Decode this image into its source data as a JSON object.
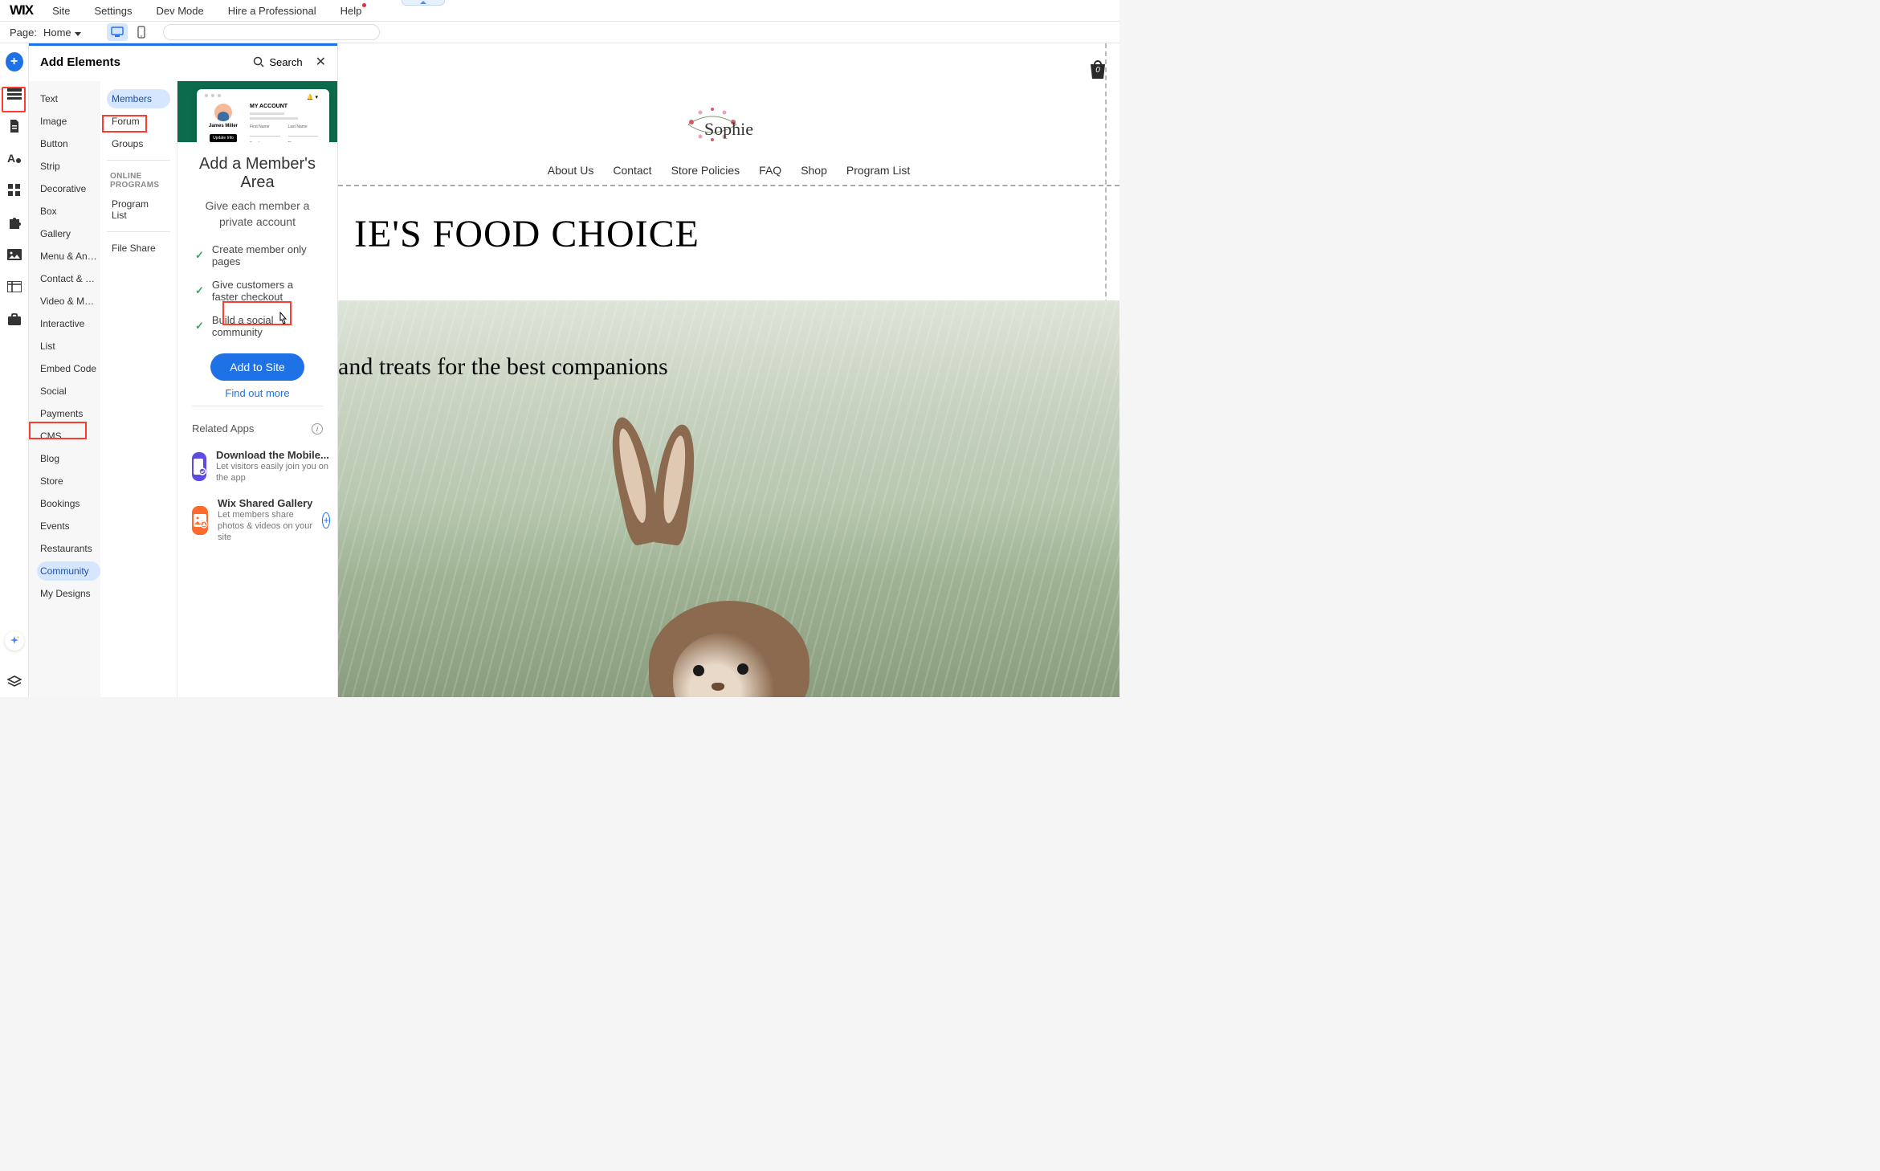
{
  "brand": "WIX",
  "top_menu": [
    "Site",
    "Settings",
    "Dev Mode",
    "Hire a Professional",
    "Help"
  ],
  "page_bar": {
    "label": "Page:",
    "current": "Home"
  },
  "panel": {
    "title": "Add Elements",
    "search_label": "Search",
    "categories": [
      "Text",
      "Image",
      "Button",
      "Strip",
      "Decorative",
      "Box",
      "Gallery",
      "Menu & Anchor",
      "Contact & Forms",
      "Video & Music",
      "Interactive",
      "List",
      "Embed Code",
      "Social",
      "Payments",
      "CMS",
      "Blog",
      "Store",
      "Bookings",
      "Events",
      "Restaurants",
      "Community",
      "My Designs"
    ],
    "selected_category": "Community",
    "subitems_primary": [
      "Members",
      "Forum",
      "Groups"
    ],
    "selected_subitem": "Members",
    "subheading": "ONLINE PROGRAMS",
    "subitems_secondary": [
      "Program List"
    ],
    "subitems_tertiary": [
      "File Share"
    ],
    "preview": {
      "title": "MY ACCOUNT",
      "name": "James Miller",
      "update_btn": "Update Info",
      "fields": [
        "First Name",
        "Last Name",
        "Email",
        "Phone"
      ]
    },
    "detail": {
      "heading": "Add a Member's Area",
      "subheading": "Give each member a private account",
      "features": [
        "Create member only pages",
        "Give customers a faster checkout",
        "Build a social community"
      ],
      "cta": "Add to Site",
      "find_more": "Find out more"
    },
    "related": {
      "heading": "Related Apps",
      "apps": [
        {
          "title": "Download the Mobile...",
          "desc": "Let visitors easily join you on the app",
          "icon": "phone"
        },
        {
          "title": "Wix Shared Gallery",
          "desc": "Let members share photos & videos on your site",
          "icon": "gallery"
        }
      ]
    }
  },
  "site": {
    "logo": "Sophie",
    "nav": [
      "About Us",
      "Contact",
      "Store Policies",
      "FAQ",
      "Shop",
      "Program List"
    ],
    "cart_count": "0",
    "hero_title": "IE'S FOOD CHOICE",
    "hero_sub": "and treats for the best companions"
  }
}
